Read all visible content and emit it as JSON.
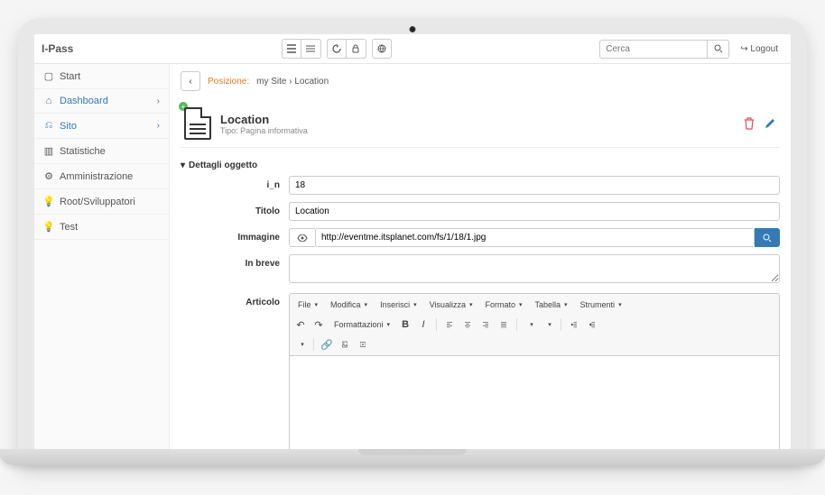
{
  "brand": "I-Pass",
  "topbar": {
    "search_placeholder": "Cerca",
    "logout": "Logout"
  },
  "sidebar": {
    "items": [
      {
        "label": "Start",
        "icon": "monitor"
      },
      {
        "label": "Dashboard",
        "icon": "home",
        "active": true,
        "expandable": true
      },
      {
        "label": "Sito",
        "icon": "sitemap",
        "active": true,
        "expandable": true
      },
      {
        "label": "Statistiche",
        "icon": "barchart"
      },
      {
        "label": "Amministrazione",
        "icon": "cogs"
      },
      {
        "label": "Root/Sviluppatori",
        "icon": "bulb"
      },
      {
        "label": "Test",
        "icon": "bulb"
      }
    ]
  },
  "breadcrumb": {
    "label": "Posizione:",
    "path": "my Site › Location"
  },
  "page": {
    "title": "Location",
    "subtitle": "Tipo: Pagina informativa"
  },
  "section_title": "Dettagli oggetto",
  "fields": {
    "i_n": {
      "label": "i_n",
      "value": "18"
    },
    "titolo": {
      "label": "Titolo",
      "value": "Location"
    },
    "immagine": {
      "label": "Immagine",
      "value": "http://eventme.itsplanet.com/fs/1/18/1.jpg"
    },
    "in_breve": {
      "label": "In breve",
      "value": ""
    },
    "articolo": {
      "label": "Articolo"
    }
  },
  "editor": {
    "menus": [
      "File",
      "Modifica",
      "Inserisci",
      "Visualizza",
      "Formato",
      "Tabella",
      "Strumenti"
    ],
    "format_label": "Formattazioni"
  }
}
